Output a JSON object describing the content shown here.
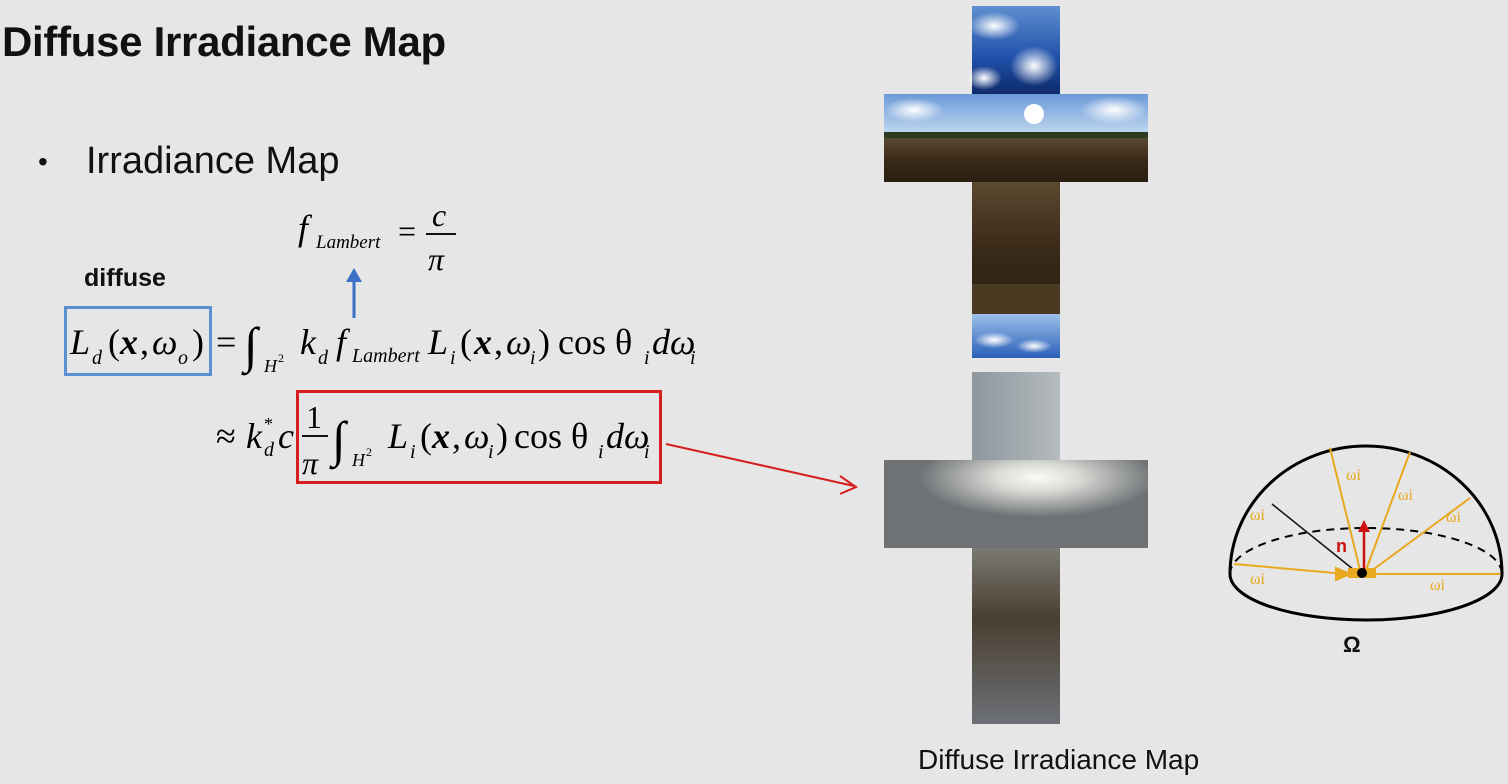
{
  "slide": {
    "title": "Diffuse Irradiance Map",
    "bullet": "Irradiance Map",
    "diffuse_label": "diffuse"
  },
  "equations": {
    "lambert": {
      "f": "f",
      "sub": "Lambert",
      "eq": "=",
      "num": "c",
      "den": "π"
    },
    "rendering": {
      "lhs": "L",
      "lhs_sub": "d",
      "lhs_args": "(x, ω",
      "lhs_args_sub": "o",
      "integral_domain": "H",
      "integral_domain_sup": "2",
      "kd": "k",
      "kd_sub": "d",
      "f": "f",
      "f_sub": "Lambert",
      "Li": "L",
      "Li_sub": "i",
      "cos": "cos θ",
      "cos_sub": "i",
      "dw": "dω",
      "dw_sub": "i"
    },
    "approx": {
      "approx": "≈",
      "kd_star": "k",
      "kd_sub": "d",
      "kd_sup": "*",
      "c": "c",
      "frac_num": "1",
      "frac_den": "π"
    }
  },
  "figure": {
    "caption": "Diffuse Irradiance Map",
    "hemisphere": {
      "omega_label": "Ω",
      "ray_label": "ωi",
      "normal_label": "n",
      "colors": {
        "rays": "#e8a820",
        "normal": "#cc1111",
        "hemisphere": "#000000"
      }
    }
  },
  "colors": {
    "blue_box": "#5a8fd0",
    "red_box": "#d61e1e",
    "arrow_blue": "#3c6fc6",
    "background": "#e6e6e6"
  }
}
